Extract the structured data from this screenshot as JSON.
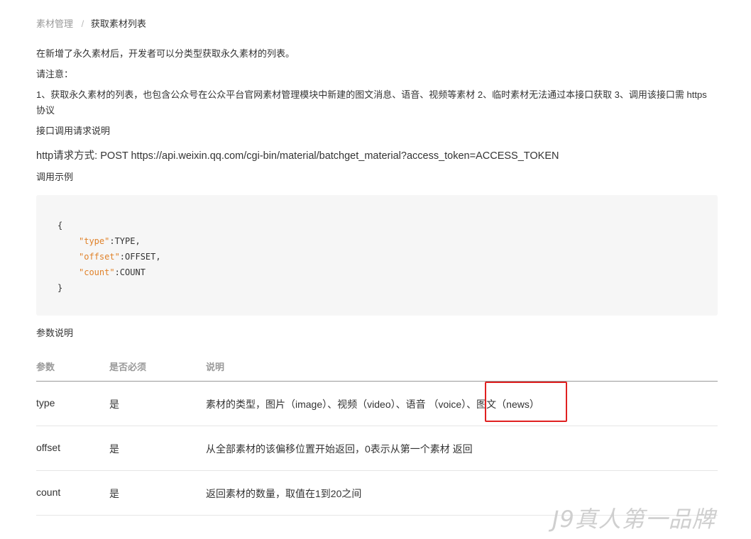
{
  "breadcrumb": {
    "parent": "素材管理",
    "separator": "/",
    "current": "获取素材列表"
  },
  "intro": "在新增了永久素材后，开发者可以分类型获取永久素材的列表。",
  "notice_title": "请注意：",
  "notice_text": "1、获取永久素材的列表，也包含公众号在公众平台官网素材管理模块中新建的图文消息、语音、视频等素材 2、临时素材无法通过本接口获取 3、调用该接口需 https 协议",
  "api_desc_title": "接口调用请求说明",
  "http_line": "http请求方式: POST https://api.weixin.qq.com/cgi-bin/material/batchget_material?access_token=ACCESS_TOKEN",
  "example_title": "调用示例",
  "code": {
    "open": "{",
    "close": "}",
    "lines": [
      {
        "key": "\"type\"",
        "value": ":TYPE,"
      },
      {
        "key": "\"offset\"",
        "value": ":OFFSET,"
      },
      {
        "key": "\"count\"",
        "value": ":COUNT"
      }
    ]
  },
  "params_title": "参数说明",
  "table": {
    "headers": [
      "参数",
      "是否必须",
      "说明"
    ],
    "rows": [
      [
        "type",
        "是",
        "素材的类型，图片（image）、视频（video）、语音 （voice）、图文（news）"
      ],
      [
        "offset",
        "是",
        "从全部素材的该偏移位置开始返回，0表示从第一个素材 返回"
      ],
      [
        "count",
        "是",
        "返回素材的数量，取值在1到20之间"
      ]
    ]
  },
  "watermark": "J9真人第一品牌",
  "colors": {
    "code_key": "#e0822a",
    "highlight": "#e02020",
    "code_background": "#f6f6f6"
  }
}
